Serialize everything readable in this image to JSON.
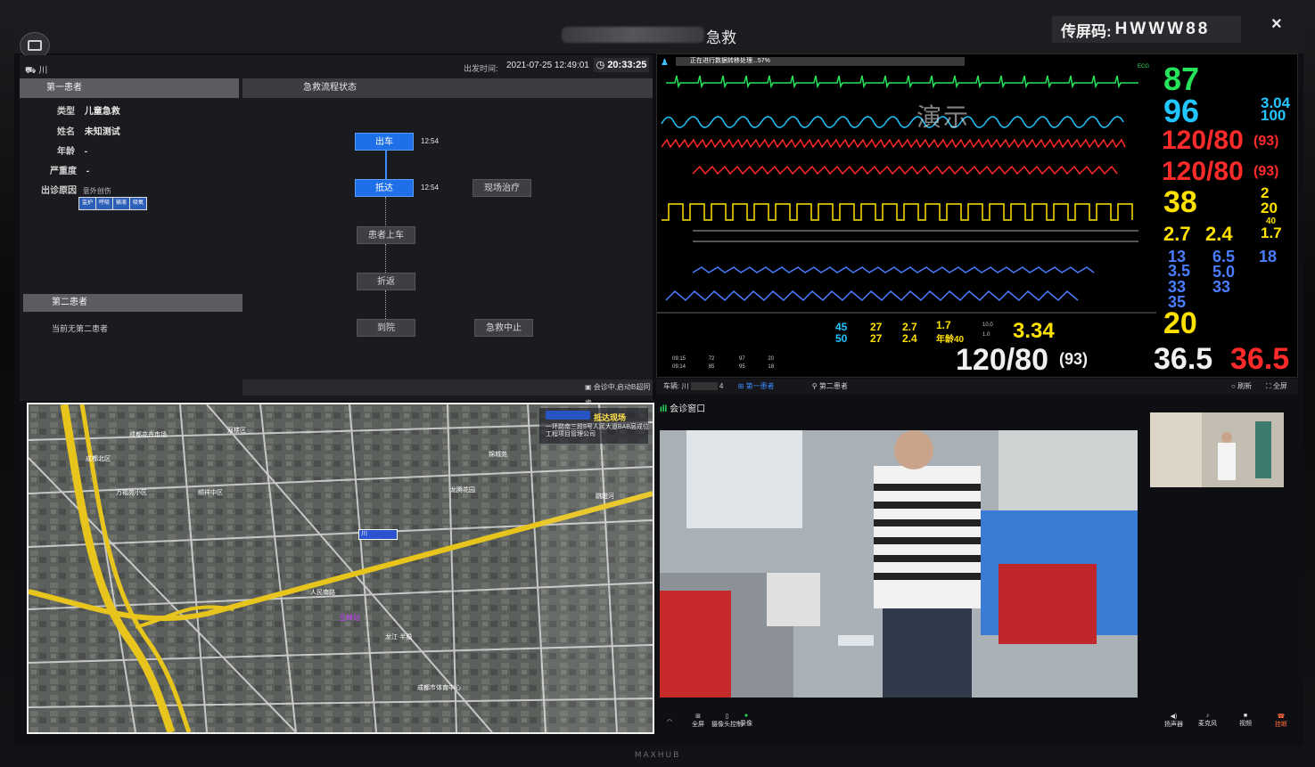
{
  "header": {
    "title": "急救",
    "cast_label": "传屏码:",
    "cast_code": "HWWW88",
    "close": "×"
  },
  "trip": {
    "vehicle_prefix": "川",
    "depart_label": "出发时间:",
    "depart_time": "2021-07-25 12:49:01",
    "elapsed": "20:33:25"
  },
  "patient1": {
    "header": "第一患者",
    "fields": [
      {
        "label": "类型",
        "value": "儿童急救"
      },
      {
        "label": "姓名",
        "value": "未知测试"
      },
      {
        "label": "年龄",
        "value": "-"
      },
      {
        "label": "严重度",
        "value": "-"
      },
      {
        "label": "出诊原因",
        "value": "意外创伤"
      }
    ],
    "tags": [
      "监护",
      "呼吸",
      "输液",
      "吸氧"
    ]
  },
  "flow": {
    "header": "急救流程状态",
    "steps": [
      {
        "label": "出车",
        "time": "12:54",
        "active": true
      },
      {
        "label": "抵达",
        "time": "12:54",
        "active": true
      },
      {
        "label": "现场治疗",
        "time": "",
        "active": false
      },
      {
        "label": "患者上车",
        "time": "",
        "active": false
      },
      {
        "label": "折返",
        "time": "",
        "active": false
      },
      {
        "label": "到院",
        "time": "",
        "active": false
      },
      {
        "label": "急救中止",
        "time": "",
        "active": false
      }
    ]
  },
  "patient2": {
    "header": "第二患者",
    "empty_text": "当前无第二患者"
  },
  "sync": {
    "text": "会诊中,启动B超同步"
  },
  "map": {
    "dest_title": "抵达现场",
    "dest_address": "一环路南三段8号人民大道BAB层成位工程项目管理公司",
    "car_label": "川",
    "labels": [
      "双楼区",
      "成都花卉市场",
      "万福苑小区",
      "顺祥中区",
      "龙江·半稳",
      "玉林站",
      "锦城苑",
      "成都市体育中心",
      "龙腾花园",
      "成都北区",
      "跳蹬河",
      "人民南路"
    ]
  },
  "monitor": {
    "status": "正在进行数据转移处理...57%",
    "demo": "演示",
    "ecg_label": "ECG",
    "hr": "87",
    "spo2": "96",
    "art": "120/80",
    "art_mean": "(93)",
    "part": "120/80",
    "part_mean": "(93)",
    "co2": "38",
    "co2_side": "2",
    "co2_side2": "20",
    "svv": "2.7",
    "sv": "2.4",
    "mac": "1.7",
    "mac_side": "40",
    "pvc": "3.04",
    "pvc2": "100",
    "paw_a": "13",
    "paw_b": "3.5",
    "paw_c": "33",
    "paw_d": "35",
    "pmean": "6.5",
    "pplat": "5.0",
    "compl": "33",
    "resp_side": "18",
    "co": "3.34",
    "resp": "20",
    "nibp": "120/80",
    "nibp_mean": "(93)",
    "t1": "36.5",
    "t2": "36.5",
    "gas_n2o": "45",
    "gas_n2o_2": "50",
    "gas_o2": "27",
    "gas_o2_2": "27",
    "gas_sev": "2.7",
    "gas_sev_2": "2.4",
    "gas_mac": "1.7",
    "gas_age": "年龄40",
    "ccd_1": "10.0",
    "ccd_2": "1.0",
    "trend_rows": [
      {
        "time": "09:15",
        "hr": "72",
        "spo2": "97",
        "rr": "20"
      },
      {
        "time": "09:14",
        "hr": "85",
        "spo2": "95",
        "rr": "18"
      }
    ]
  },
  "monitor_footer": {
    "vehicle": "车辆: 川",
    "vehicle_suffix": "4",
    "tab1": "第一患者",
    "tab2": "第二患者",
    "refresh": "刷新",
    "fullscreen": "全屏"
  },
  "video": {
    "header": "会诊窗口",
    "controls": {
      "fullscreen": "全屏",
      "camera": "摄像头控制",
      "record": "录像",
      "speaker": "扬声器",
      "mic": "麦克风",
      "video": "视频",
      "hangup": "挂断"
    }
  },
  "brand": "MAXHUB"
}
